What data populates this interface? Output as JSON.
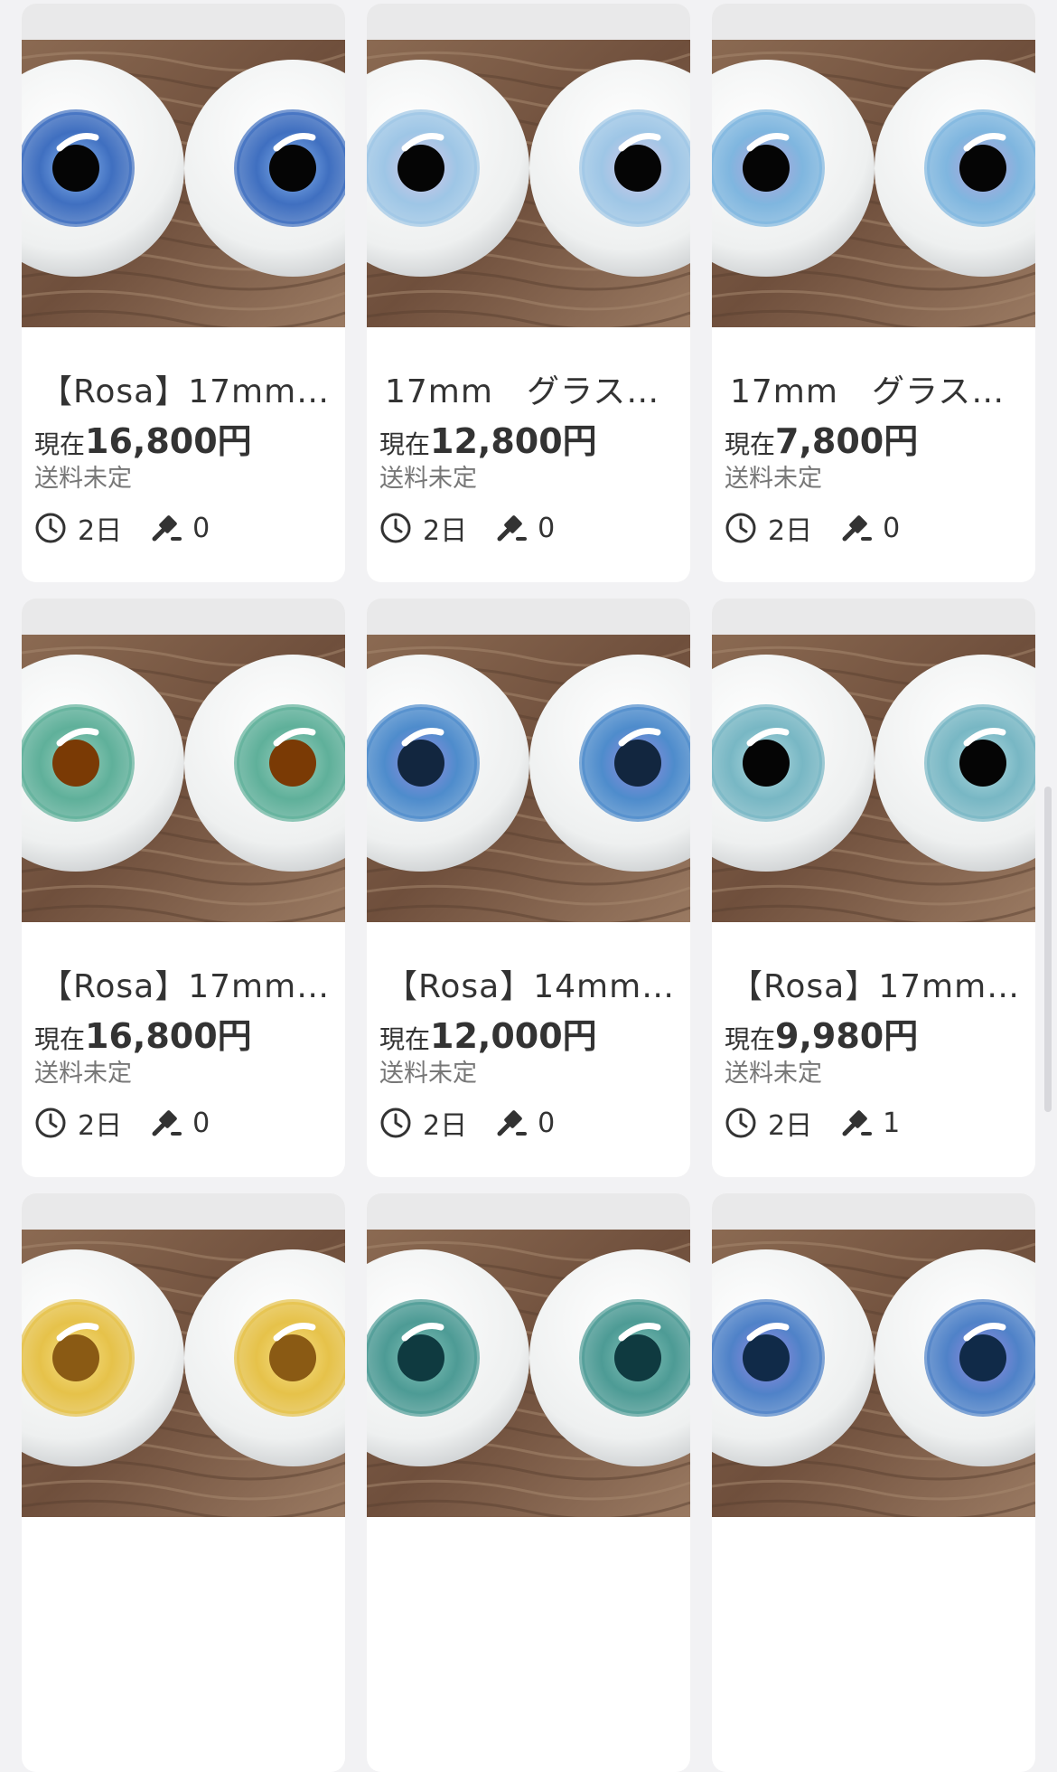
{
  "listings": [
    {
      "title": "【Rosa】17mm…",
      "price_prefix": "現在",
      "price": "16,800円",
      "shipping": "送料未定",
      "time_left": "2日",
      "bids": "0",
      "iris_color": "#3f6fc0",
      "iris_inner": "#8db8f0",
      "pupil_color": "#050505",
      "bg_image": "eyes-photo"
    },
    {
      "title": "17mm　グラスア…",
      "price_prefix": "現在",
      "price": "12,800円",
      "shipping": "送料未定",
      "time_left": "2日",
      "bids": "0",
      "iris_color": "#9ec6e6",
      "iris_inner": "#d9c6e8",
      "pupil_color": "#050505",
      "bg_image": "eyes-photo"
    },
    {
      "title": "17mm　グラスア…",
      "price_prefix": "現在",
      "price": "7,800円",
      "shipping": "送料未定",
      "time_left": "2日",
      "bids": "0",
      "iris_color": "#7fb6df",
      "iris_inner": "#b9a3db",
      "pupil_color": "#050505",
      "bg_image": "eyes-photo"
    },
    {
      "title": "【Rosa】17mm…",
      "price_prefix": "現在",
      "price": "16,800円",
      "shipping": "送料未定",
      "time_left": "2日",
      "bids": "0",
      "iris_color": "#5fb09a",
      "iris_inner": "#9fd2c1",
      "pupil_color": "#7a3a05",
      "bg_image": "eyes-photo"
    },
    {
      "title": "【Rosa】14mm…",
      "price_prefix": "現在",
      "price": "12,000円",
      "shipping": "送料未定",
      "time_left": "2日",
      "bids": "0",
      "iris_color": "#4e8ccc",
      "iris_inner": "#9a8ce0",
      "pupil_color": "#12263f",
      "bg_image": "eyes-photo"
    },
    {
      "title": "【Rosa】17mm…",
      "price_prefix": "現在",
      "price": "9,980円",
      "shipping": "送料未定",
      "time_left": "2日",
      "bids": "1",
      "iris_color": "#78b7c4",
      "iris_inner": "#b6dde2",
      "pupil_color": "#050505",
      "bg_image": "eyes-photo"
    },
    {
      "title": "",
      "price_prefix": "",
      "price": "",
      "shipping": "",
      "time_left": "",
      "bids": "",
      "iris_color": "#e6c24a",
      "iris_inner": "#f6e08a",
      "pupil_color": "#8a5a14",
      "bg_image": "eyes-photo"
    },
    {
      "title": "",
      "price_prefix": "",
      "price": "",
      "shipping": "",
      "time_left": "",
      "bids": "",
      "iris_color": "#4d9b95",
      "iris_inner": "#87c4bb",
      "pupil_color": "#0f3a40",
      "bg_image": "eyes-photo"
    },
    {
      "title": "",
      "price_prefix": "",
      "price": "",
      "shipping": "",
      "time_left": "",
      "bids": "",
      "iris_color": "#4f82c8",
      "iris_inner": "#9c8ce2",
      "pupil_color": "#102a48",
      "bg_image": "eyes-photo"
    }
  ],
  "colors": {
    "background": "#f2f2f4",
    "card": "#ffffff",
    "text": "#333333",
    "subtext": "#777777",
    "photo_bg": "#7b5a45"
  },
  "icons": {
    "time": "clock-icon",
    "bids": "gavel-icon"
  }
}
